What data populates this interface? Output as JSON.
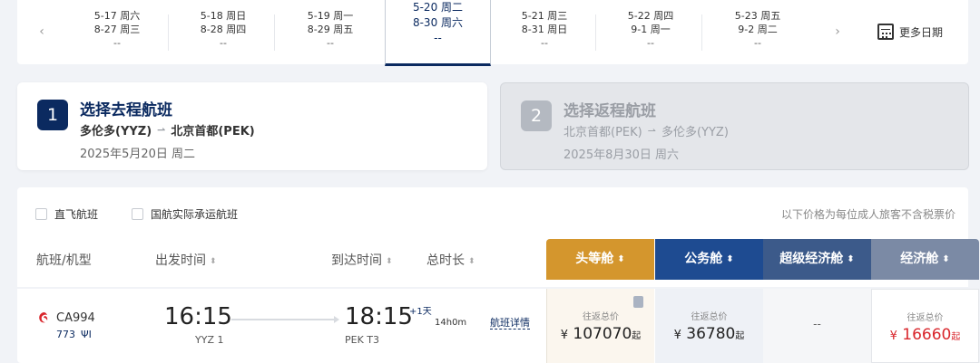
{
  "date_strip": {
    "prev": "‹",
    "next": "›",
    "dates": [
      {
        "out": "5-17 周六",
        "ret": "8-27 周三",
        "price": "--"
      },
      {
        "out": "5-18 周日",
        "ret": "8-28 周四",
        "price": "--"
      },
      {
        "out": "5-19 周一",
        "ret": "8-29 周五",
        "price": "--"
      },
      {
        "out": "5-20 周二",
        "ret": "8-30 周六",
        "price": "--"
      },
      {
        "out": "5-21 周三",
        "ret": "8-31 周日",
        "price": "--"
      },
      {
        "out": "5-22 周四",
        "ret": "9-1 周一",
        "price": "--"
      },
      {
        "out": "5-23 周五",
        "ret": "9-2 周二",
        "price": "--"
      }
    ],
    "active_index": 3,
    "more_label": "更多日期"
  },
  "steps": [
    {
      "number": "1",
      "title": "选择去程航班",
      "from": "多伦多(YYZ)",
      "to": "北京首都(PEK)",
      "date": "2025年5月20日 周二",
      "active": true
    },
    {
      "number": "2",
      "title": "选择返程航班",
      "from": "北京首都(PEK)",
      "to": "多伦多(YYZ)",
      "date": "2025年8月30日 周六",
      "active": false
    }
  ],
  "filters": {
    "direct": "直飞航班",
    "ca_operated": "国航实际承运航班",
    "note": "以下价格为每位成人旅客不含税票价"
  },
  "headers": {
    "flight": "航班/机型",
    "dep": "出发时间",
    "arr": "到达时间",
    "dur": "总时长"
  },
  "cabins": {
    "first": "头等舱",
    "business": "公务舱",
    "premium": "超级经济舱",
    "economy": "经济舱",
    "sort_icon": "⬍"
  },
  "flight": {
    "number": "CA994",
    "aircraft": "773",
    "meal_icon": "ΨΙ",
    "dep_time": "16:15",
    "dep_airport": "YYZ 1",
    "arr_time": "18:15",
    "plus_day": "+1天",
    "arr_airport": "PEK T3",
    "duration": "14h0m",
    "details_link": "航班详情"
  },
  "prices": {
    "label": "往返总价",
    "yen": "¥",
    "suffix": "起",
    "first": "107070",
    "business": "36780",
    "premium": "--",
    "economy": "16660"
  },
  "colors": {
    "brand_navy": "#0b2a60",
    "first": "#d4962d",
    "business": "#1e4b91",
    "premium": "#3c5a8a",
    "economy": "#7b8aa5",
    "price_red": "#d9262c"
  }
}
